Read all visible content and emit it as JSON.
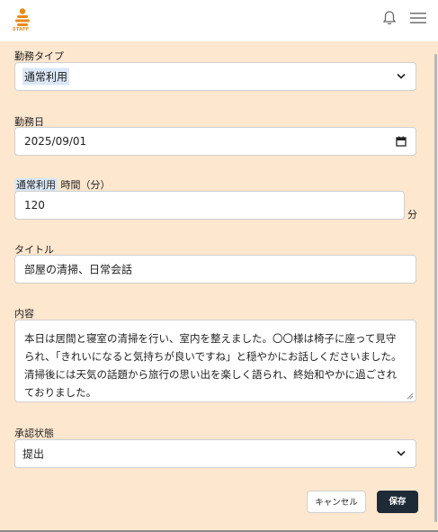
{
  "header": {
    "logo_text": "STAFF",
    "icons": [
      "bell-icon",
      "hamburger-menu-icon"
    ]
  },
  "form": {
    "work_type": {
      "label": "勤務タイプ",
      "value": "通常利用"
    },
    "work_date": {
      "label": "勤務日",
      "value": "2025/09/01"
    },
    "duration": {
      "label_highlight": "通常利用",
      "label_suffix": " 時間（分）",
      "value": "120",
      "unit": "分"
    },
    "title": {
      "label": "タイトル",
      "value": "部屋の清掃、日常会話"
    },
    "content": {
      "label": "内容",
      "value": "本日は居間と寝室の清掃を行い、室内を整えました。〇〇様は椅子に座って見守られ、「きれいになると気持ちが良いですね」と穏やかにお話しくださいました。清掃後には天気の話題から旅行の思い出を楽しく語られ、終始和やかに過ごされておりました。"
    },
    "approval": {
      "label": "承認状態",
      "value": "提出"
    }
  },
  "buttons": {
    "cancel": "キャンセル",
    "save": "保存"
  },
  "colors": {
    "background": "#fde7cf",
    "save_button": "#1f2a37",
    "highlight": "#dbe7f6",
    "logo": "#e8891a"
  }
}
